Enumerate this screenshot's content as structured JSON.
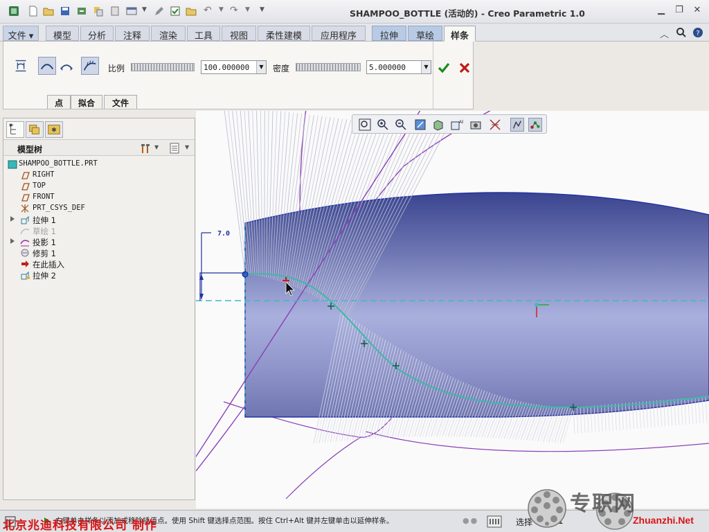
{
  "window": {
    "title": "SHAMPOO_BOTTLE (活动的) - Creo Parametric 1.0"
  },
  "ribbon": {
    "tabs": [
      {
        "label": "文件 ▾",
        "kind": "main"
      },
      {
        "label": "模型",
        "kind": "main"
      },
      {
        "label": "分析",
        "kind": "main"
      },
      {
        "label": "注释",
        "kind": "main"
      },
      {
        "label": "渲染",
        "kind": "main"
      },
      {
        "label": "工具",
        "kind": "main"
      },
      {
        "label": "视图",
        "kind": "main"
      },
      {
        "label": "柔性建模",
        "kind": "main"
      },
      {
        "label": "应用程序",
        "kind": "main"
      },
      {
        "label": "拉伸",
        "kind": "ctx"
      },
      {
        "label": "草绘",
        "kind": "ctx"
      },
      {
        "label": "样条",
        "kind": "active"
      }
    ],
    "scale_label": "比例",
    "scale_value": "100.000000",
    "density_label": "密度",
    "density_value": "5.000000",
    "subtabs": [
      "点",
      "拟合",
      "文件"
    ],
    "accept_icon": "check-icon",
    "cancel_icon": "x-icon"
  },
  "model_tree": {
    "title": "模型树",
    "items": [
      {
        "label": "SHAMPOO_BOTTLE.PRT",
        "icon": "part-icon",
        "expandable": false,
        "dim": false,
        "cjk": false
      },
      {
        "label": "RIGHT",
        "icon": "datum-plane-icon",
        "expandable": false,
        "dim": false,
        "cjk": false
      },
      {
        "label": "TOP",
        "icon": "datum-plane-icon",
        "expandable": false,
        "dim": false,
        "cjk": false
      },
      {
        "label": "FRONT",
        "icon": "datum-plane-icon",
        "expandable": false,
        "dim": false,
        "cjk": false
      },
      {
        "label": "PRT_CSYS_DEF",
        "icon": "csys-icon",
        "expandable": false,
        "dim": false,
        "cjk": false
      },
      {
        "label": "拉伸 1",
        "icon": "extrude-icon",
        "expandable": true,
        "dim": false,
        "cjk": true
      },
      {
        "label": "草绘 1",
        "icon": "sketch-icon",
        "expandable": false,
        "dim": true,
        "cjk": true
      },
      {
        "label": "投影 1",
        "icon": "project-icon",
        "expandable": true,
        "dim": false,
        "cjk": true
      },
      {
        "label": "修剪 1",
        "icon": "trim-icon",
        "expandable": false,
        "dim": false,
        "cjk": true
      },
      {
        "label": "在此插入",
        "icon": "insert-arrow-icon",
        "expandable": false,
        "dim": false,
        "cjk": true
      },
      {
        "label": "拉伸 2",
        "icon": "extrude-active-icon",
        "expandable": false,
        "dim": false,
        "cjk": true
      }
    ]
  },
  "graphics": {
    "dimension_text": "7.0"
  },
  "statusbar": {
    "message": "右键单击样条以添加或移除插值点。使用 Shift 键选择点范围。按住 Ctrl+Alt 键并左键单击以延伸样条。",
    "select_label": "选择",
    "select_count": "1"
  },
  "watermark": {
    "company": "北京兆迪科技有限公司   制作",
    "logo_text": "专职网",
    "logo_url": "Zhuanzhi.Net"
  },
  "colors": {
    "accent_blue": "#5a64a8",
    "curvature_comb": "#8a7fc0",
    "spline_cyan": "#3fb8a8",
    "confirm_green": "#1c8a1c",
    "cancel_red": "#c01818",
    "watermark_red": "#d81414"
  }
}
